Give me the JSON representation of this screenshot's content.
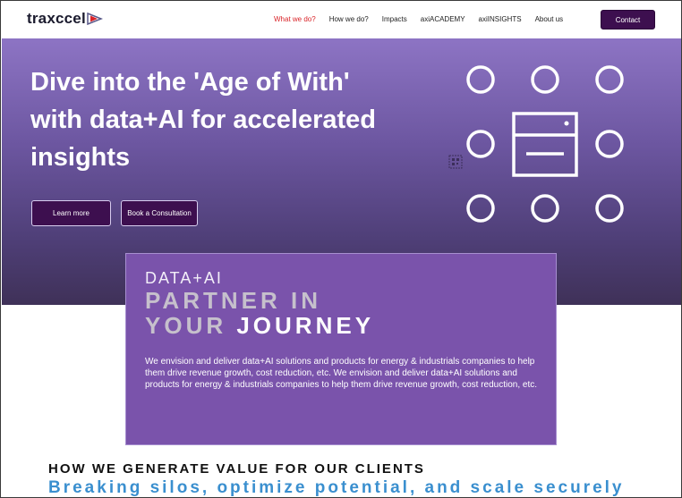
{
  "header": {
    "logo_text": "traxccel",
    "nav": [
      {
        "label": "What we do?",
        "active": true
      },
      {
        "label": "How we do?",
        "active": false
      },
      {
        "label": "Impacts",
        "active": false
      },
      {
        "label": "axiACADEMY",
        "active": false
      },
      {
        "label": "axiINSIGHTS",
        "active": false
      },
      {
        "label": "About us",
        "active": false
      }
    ],
    "contact_label": "Contact"
  },
  "hero": {
    "title": "Dive into the 'Age of With' with data+AI for accelerated insights",
    "learn_more_label": "Learn more",
    "book_label": "Book a Consultation"
  },
  "card": {
    "eyebrow": "DATA+AI",
    "head_line1_gray": "PARTNER ",
    "head_line1_white": "IN",
    "head_line2_gray": "YOUR ",
    "head_line2_white": "JOURNEY",
    "body": "We envision and deliver data+AI solutions and products for energy & industrials companies to help them drive revenue growth, cost reduction, etc.  We envision and deliver data+AI solutions and products for energy & industrials companies to help them drive revenue growth, cost reduction, etc."
  },
  "value_section": {
    "title": "HOW WE GENERATE VALUE FOR OUR CLIENTS",
    "subtitle": "Breaking silos, optimize potential, and scale securely"
  },
  "colors": {
    "brand_dark_purple": "#3d0f4f",
    "hero_purple": "#7a53ab",
    "nav_active_red": "#d9252a",
    "subtitle_blue": "#3a8fcf"
  },
  "icons": {
    "logo_mark": "play-triangle-icon",
    "qr": "qr-code-icon",
    "hero_graphic": "server-network-icon"
  }
}
